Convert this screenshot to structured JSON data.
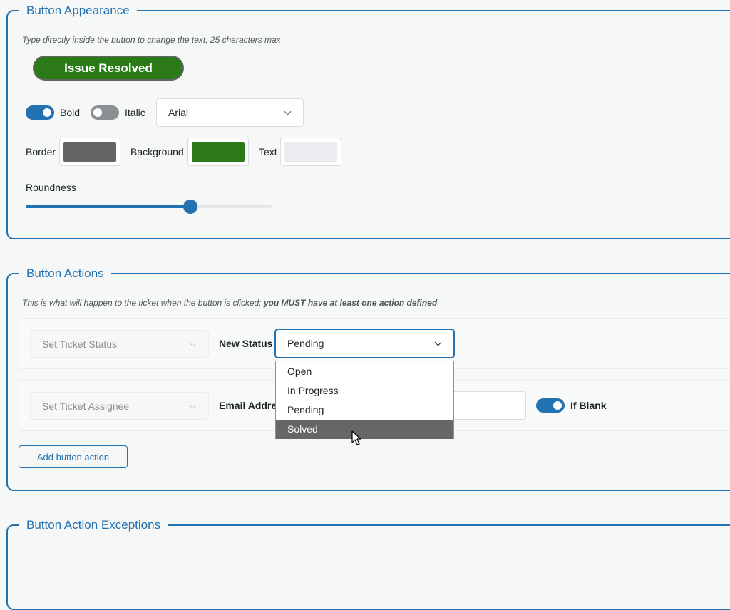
{
  "appearance": {
    "legend": "Button Appearance",
    "hint": "Type directly inside the button to change the text; 25 characters max",
    "preview_label": "Issue Resolved",
    "bold_label": "Bold",
    "bold_on": true,
    "italic_label": "Italic",
    "italic_on": false,
    "font_value": "Arial",
    "border_label": "Border",
    "border_color": "#646464",
    "background_label": "Background",
    "background_color": "#2c7a17",
    "text_label": "Text",
    "text_color": "#ececf0",
    "roundness_label": "Roundness",
    "roundness_percent": 67
  },
  "actions": {
    "legend": "Button Actions",
    "hint_plain": "This is what will happen to the ticket when the button is clicked; ",
    "hint_bold": "you MUST have at least one action defined",
    "row1": {
      "action_select": "Set Ticket Status",
      "field_label": "New Status:",
      "value": "Pending"
    },
    "row2": {
      "action_select": "Set Ticket Assignee",
      "field_label": "Email Address:",
      "if_blank_label": "If Blank",
      "if_blank_on": true
    },
    "status_options": [
      "Open",
      "In Progress",
      "Pending",
      "Solved"
    ],
    "highlighted_option": "Solved",
    "add_action_label": "Add button action"
  },
  "exceptions": {
    "legend": "Button Action Exceptions"
  },
  "colors": {
    "accent": "#2271b1"
  },
  "icons": [
    "chevron-down-icon",
    "mouse-cursor-icon"
  ]
}
